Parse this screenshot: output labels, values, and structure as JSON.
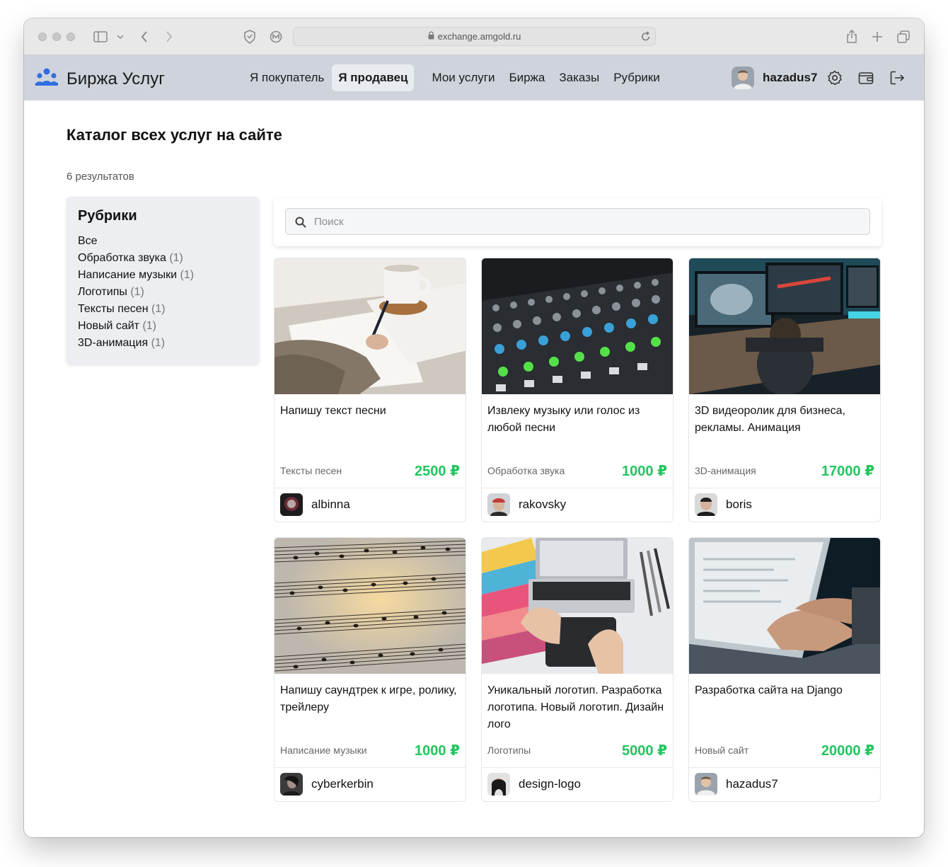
{
  "browser": {
    "url": "exchange.amgold.ru"
  },
  "header": {
    "logo_text": "Биржа Услуг",
    "nav": [
      {
        "label": "Я покупатель",
        "active": false
      },
      {
        "label": "Я продавец",
        "active": true
      },
      {
        "label": "Мои услуги",
        "active": false
      },
      {
        "label": "Биржа",
        "active": false
      },
      {
        "label": "Заказы",
        "active": false
      },
      {
        "label": "Рубрики",
        "active": false
      }
    ],
    "username": "hazadus7"
  },
  "page": {
    "title": "Каталог всех услуг на сайте",
    "results": "6 результатов"
  },
  "sidebar": {
    "title": "Рубрики",
    "categories": [
      {
        "label": "Все",
        "count": ""
      },
      {
        "label": "Обработка звука",
        "count": "(1)"
      },
      {
        "label": "Написание музыки",
        "count": "(1)"
      },
      {
        "label": "Логотипы",
        "count": "(1)"
      },
      {
        "label": "Тексты песен",
        "count": "(1)"
      },
      {
        "label": "Новый сайт",
        "count": "(1)"
      },
      {
        "label": "3D-анимация",
        "count": "(1)"
      }
    ]
  },
  "search": {
    "placeholder": "Поиск"
  },
  "cards": [
    {
      "title": "Напишу текст песни",
      "category": "Тексты песен",
      "price": "2500 ₽",
      "seller": "albinna"
    },
    {
      "title": "Извлеку музыку или голос из любой песни",
      "category": "Обработка звука",
      "price": "1000 ₽",
      "seller": "rakovsky"
    },
    {
      "title": "3D видеоролик для бизнеса, рекламы. Анимация",
      "category": "3D-анимация",
      "price": "17000 ₽",
      "seller": "boris"
    },
    {
      "title": "Напишу саундтрек к игре, ролику, трейлеру",
      "category": "Написание музыки",
      "price": "1000 ₽",
      "seller": "cyberkerbin"
    },
    {
      "title": "Уникальный логотип. Разработка логотипа. Новый логотип. Дизайн лого",
      "category": "Логотипы",
      "price": "5000 ₽",
      "seller": "design-logo"
    },
    {
      "title": "Разработка сайта на Django",
      "category": "Новый сайт",
      "price": "20000 ₽",
      "seller": "hazadus7"
    }
  ],
  "colors": {
    "header_bg": "#cfd4dc",
    "price": "#22c55e",
    "logo_blue": "#2f6fe0"
  }
}
